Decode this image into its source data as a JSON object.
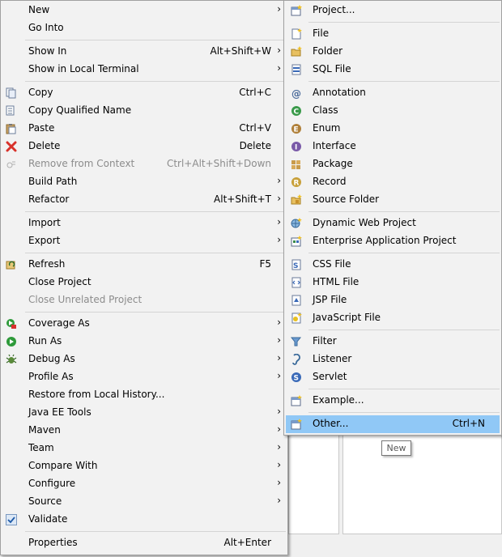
{
  "main_menu": {
    "new": {
      "label": "New"
    },
    "go_into": {
      "label": "Go Into"
    },
    "show_in": {
      "label": "Show In",
      "shortcut": "Alt+Shift+W"
    },
    "show_in_terminal": {
      "label": "Show in Local Terminal"
    },
    "copy": {
      "label": "Copy",
      "shortcut": "Ctrl+C"
    },
    "copy_qualified": {
      "label": "Copy Qualified Name"
    },
    "paste": {
      "label": "Paste",
      "shortcut": "Ctrl+V"
    },
    "delete": {
      "label": "Delete",
      "shortcut": "Delete"
    },
    "remove_context": {
      "label": "Remove from Context",
      "shortcut": "Ctrl+Alt+Shift+Down"
    },
    "build_path": {
      "label": "Build Path"
    },
    "refactor": {
      "label": "Refactor",
      "shortcut": "Alt+Shift+T"
    },
    "import": {
      "label": "Import"
    },
    "export": {
      "label": "Export"
    },
    "refresh": {
      "label": "Refresh",
      "shortcut": "F5"
    },
    "close_project": {
      "label": "Close Project"
    },
    "close_unrelated": {
      "label": "Close Unrelated Project"
    },
    "coverage_as": {
      "label": "Coverage As"
    },
    "run_as": {
      "label": "Run As"
    },
    "debug_as": {
      "label": "Debug As"
    },
    "profile_as": {
      "label": "Profile As"
    },
    "restore_history": {
      "label": "Restore from Local History..."
    },
    "java_ee_tools": {
      "label": "Java EE Tools"
    },
    "maven": {
      "label": "Maven"
    },
    "team": {
      "label": "Team"
    },
    "compare_with": {
      "label": "Compare With"
    },
    "configure": {
      "label": "Configure"
    },
    "source": {
      "label": "Source"
    },
    "validate": {
      "label": "Validate"
    },
    "properties": {
      "label": "Properties",
      "shortcut": "Alt+Enter"
    }
  },
  "submenu": {
    "project": {
      "label": "Project..."
    },
    "file": {
      "label": "File"
    },
    "folder": {
      "label": "Folder"
    },
    "sql_file": {
      "label": "SQL File"
    },
    "annotation": {
      "label": "Annotation"
    },
    "class": {
      "label": "Class"
    },
    "enum": {
      "label": "Enum"
    },
    "interface": {
      "label": "Interface"
    },
    "package": {
      "label": "Package"
    },
    "record": {
      "label": "Record"
    },
    "source_folder": {
      "label": "Source Folder"
    },
    "dynamic_web": {
      "label": "Dynamic Web Project"
    },
    "enterprise_app": {
      "label": "Enterprise Application Project"
    },
    "css_file": {
      "label": "CSS File"
    },
    "html_file": {
      "label": "HTML File"
    },
    "jsp_file": {
      "label": "JSP File"
    },
    "js_file": {
      "label": "JavaScript File"
    },
    "filter": {
      "label": "Filter"
    },
    "listener": {
      "label": "Listener"
    },
    "servlet": {
      "label": "Servlet"
    },
    "example": {
      "label": "Example..."
    },
    "other": {
      "label": "Other...",
      "shortcut": "Ctrl+N"
    }
  },
  "tooltip": {
    "text": "New"
  },
  "colors": {
    "highlight": "#90c8f6",
    "menu_bg": "#f2f2f2",
    "disabled_text": "#8c8c8c"
  }
}
